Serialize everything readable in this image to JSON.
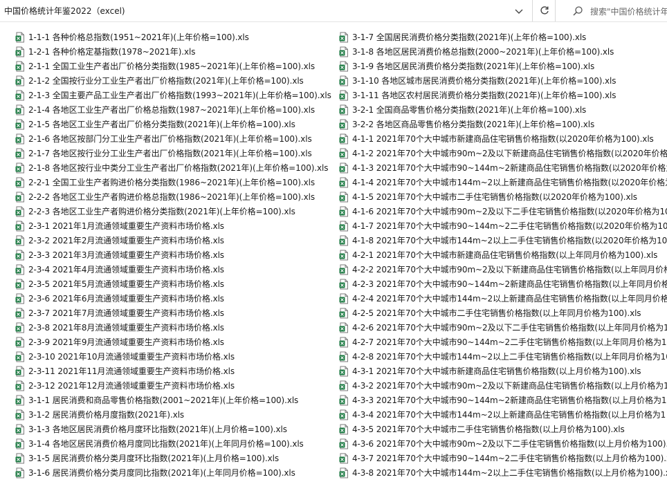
{
  "address_bar": {
    "path": "中国价格统计年鉴2022（excel)"
  },
  "search": {
    "placeholder": "搜索\"中国价格统计年鉴"
  },
  "icons": {
    "file": "excel-file-icon",
    "dropdown": "chevron-down-icon",
    "refresh": "refresh-icon",
    "search": "search-icon"
  },
  "colors": {
    "excel_green": "#1d7a43"
  },
  "files_left": [
    "1-1-1 各种价格总指数(1951~2021年)(上年价格=100).xls",
    "1-2-1 各种价格定基指数(1978~2021年).xls",
    "2-1-1 全国工业生产者出厂价格分类指数(1985~2021年)(上年价格=100).xls",
    "2-1-2 全国按行业分工业生产者出厂价格指数(2021年)(上年价格=100).xls",
    "2-1-3 全国主要产品工业生产者出厂价格指数(1993~2021年)(上年价格=100).xls",
    "2-1-4 各地区工业生产者出厂价格总指数(1987~2021年)(上年价格=100).xls",
    "2-1-5 各地区工业生产者出厂价格分类指数(2021年)(上年价格=100).xls",
    "2-1-6 各地区按部门分工业生产者出厂价格指数(2021年)(上年价格=100).xls",
    "2-1-7 各地区按行业分工业生产者出厂价格指数(2021年)(上年价格=100).xls",
    "2-1-8 各地区按行业中类分工业生产者出厂价格指数(2021年)(上年价格=100).xls",
    "2-2-1 全国工业生产者购进价格分类指数(1986~2021年)(上年价格=100).xls",
    "2-2-2 各地区工业生产者购进价格总指数(1986~2021年)(上年价格=100).xls",
    "2-2-3 各地区工业生产者购进价格分类指数(2021年)(上年价格=100).xls",
    "2-3-1 2021年1月流通领域重要生产资料市场价格.xls",
    "2-3-2 2021年2月流通领域重要生产资料市场价格.xls",
    "2-3-3 2021年3月流通领域重要生产资料市场价格.xls",
    "2-3-4 2021年4月流通领域重要生产资料市场价格.xls",
    "2-3-5 2021年5月流通领域重要生产资料市场价格.xls",
    "2-3-6 2021年6月流通领域重要生产资料市场价格.xls",
    "2-3-7 2021年7月流通领域重要生产资料市场价格.xls",
    "2-3-8 2021年8月流通领域重要生产资料市场价格.xls",
    "2-3-9 2021年9月流通领域重要生产资料市场价格.xls",
    "2-3-10 2021年10月流通领域重要生产资料市场价格.xls",
    "2-3-11 2021年11月流通领域重要生产资料市场价格.xls",
    "2-3-12 2021年12月流通领域重要生产资料市场价格.xls",
    "3-1-1 居民消费和商品零售价格指数(2001~2021年)(上年价格=100).xls",
    "3-1-2 居民消费价格月度指数(2021年).xls",
    "3-1-3 各地区居民消费价格月度环比指数(2021年)(上月价格=100).xls",
    "3-1-4 各地区居民消费价格月度同比指数(2021年)(上年同月价格=100).xls",
    "3-1-5 居民消费价格分类月度环比指数(2021年)(上月价格=100).xls",
    "3-1-6 居民消费价格分类月度同比指数(2021年)(上年同月价格=100).xls"
  ],
  "files_right": [
    "3-1-7 全国居民消费价格分类指数(2021年)(上年价格=100).xls",
    "3-1-8 各地区居民消费价格总指数(2000~2021年)(上年价格=100).xls",
    "3-1-9 各地区居民消费价格分类指数(2021年)(上年价格=100).xls",
    "3-1-10 各地区城市居民消费价格分类指数(2021年)(上年价格=100).xls",
    "3-1-11 各地区农村居民消费价格分类指数(2021年)(上年价格=100).xls",
    "3-2-1 全国商品零售价格分类指数(2021年)(上年价格=100).xls",
    "3-2-2 各地区商品零售价格分类指数(2021年)(上年价格=100).xls",
    "4-1-1 2021年70个大中城市新建商品住宅销售价格指数(以2020年价格为100).xls",
    "4-1-2 2021年70个大中城市90m~2及以下新建商品住宅销售价格指数(以2020年价格为",
    "4-1-3 2021年70个大中城市90~144m~2新建商品住宅销售价格指数(以2020年价格为",
    "4-1-4 2021年70个大中城市144m~2以上新建商品住宅销售价格指数(以2020年价格为",
    "4-1-5 2021年70个大中城市二手住宅销售价格指数(以2020年价格为100).xls",
    "4-1-6 2021年70个大中城市90m~2及以下二手住宅销售价格指数(以2020年价格为10",
    "4-1-7 2021年70个大中城市90~144m~2二手住宅销售价格指数(以2020年价格为100)",
    "4-1-8 2021年70个大中城市144m~2以上二手住宅销售价格指数(以2020年价格为100)",
    "4-2-1 2021年70个大中城市新建商品住宅销售价格指数(以上年同月价格为100).xls",
    "4-2-2 2021年70个大中城市90m~2及以下新建商品住宅销售价格指数(以上年同月价格",
    "4-2-3 2021年70个大中城市90~144m~2新建商品住宅销售价格指数(以上年同月价格",
    "4-2-4 2021年70个大中城市144m~2以上新建商品住宅销售价格指数(以上年同月价格",
    "4-2-5 2021年70个大中城市二手住宅销售价格指数(以上年同月价格为100).xls",
    "4-2-6 2021年70个大中城市90m~2及以下二手住宅销售价格指数(以上年同月价格为1",
    "4-2-7 2021年70个大中城市90~144m~2二手住宅销售价格指数(以上年同月价格为10",
    "4-2-8 2021年70个大中城市144m~2以上二手住宅销售价格指数(以上年同月价格为10",
    "4-3-1 2021年70个大中城市新建商品住宅销售价格指数(以上月价格为100).xls",
    "4-3-2 2021年70个大中城市90m~2及以下新建商品住宅销售价格指数(以上月价格为10",
    "4-3-3 2021年70个大中城市90~144m~2新建商品住宅销售价格指数(以上月价格为10",
    "4-3-4 2021年70个大中城市144m~2以上新建商品住宅销售价格指数(以上月价格为1",
    "4-3-5 2021年70个大中城市二手住宅销售价格指数(以上月价格为100).xls",
    "4-3-6 2021年70个大中城市90m~2及以下二手住宅销售价格指数(以上月价格为100).x",
    "4-3-7 2021年70个大中城市90~144m~2二手住宅销售价格指数(以上月价格为100).xls",
    "4-3-8 2021年70个大中城市144m~2以上二手住宅销售价格指数(以上月价格为100).xls"
  ]
}
